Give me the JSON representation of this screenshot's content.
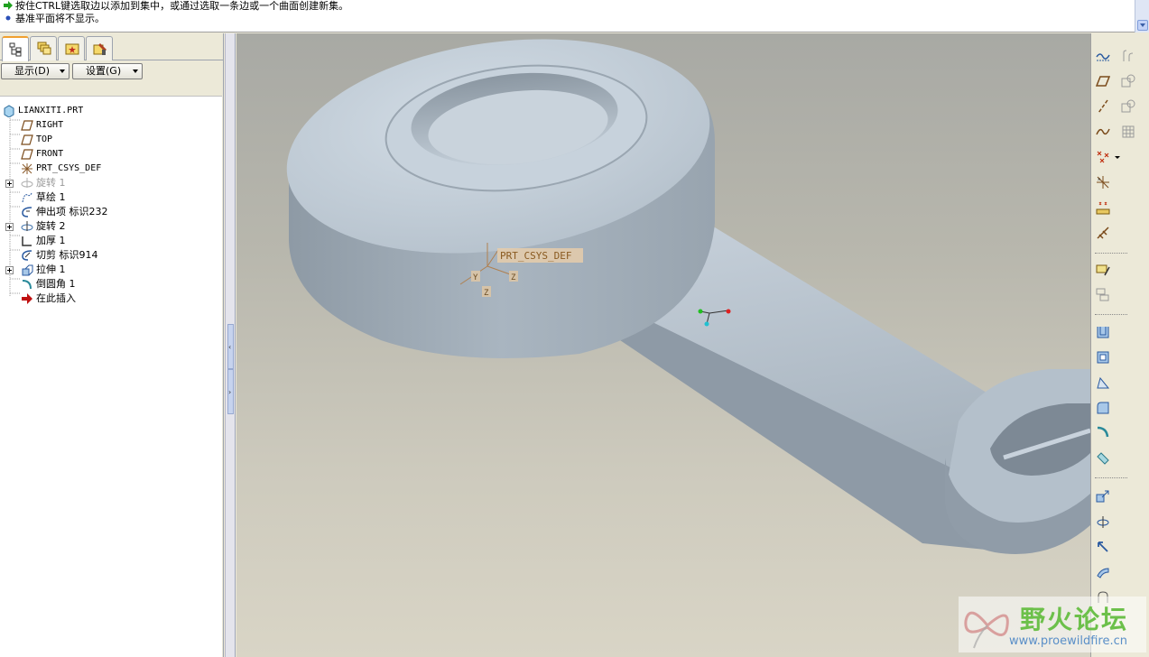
{
  "message_area": {
    "lines": [
      "按住CTRL键选取边以添加到集中，或通过选取一条边或一个曲面创建新集。",
      "基准平面将不显示。"
    ]
  },
  "model_tree_panel": {
    "tabs": [
      "model-tree-tab",
      "layers-tab",
      "favorites-tab",
      "connections-tab"
    ],
    "show_menu": "显示(D)",
    "settings_menu": "设置(G)",
    "items": [
      {
        "label": "LIANXITI.PRT",
        "icon": "part-icon",
        "expandable": false,
        "greyed": false
      },
      {
        "label": "RIGHT",
        "icon": "datum-plane-icon",
        "expandable": false,
        "greyed": false
      },
      {
        "label": "TOP",
        "icon": "datum-plane-icon",
        "expandable": false,
        "greyed": false
      },
      {
        "label": "FRONT",
        "icon": "datum-plane-icon",
        "expandable": false,
        "greyed": false
      },
      {
        "label": "PRT_CSYS_DEF",
        "icon": "csys-icon",
        "expandable": false,
        "greyed": false
      },
      {
        "label": "旋转 1",
        "icon": "revolve-icon",
        "expandable": true,
        "greyed": true
      },
      {
        "label": "草绘 1",
        "icon": "sketch-icon",
        "expandable": false,
        "greyed": false
      },
      {
        "label": "伸出项 标识232",
        "icon": "protrusion-icon",
        "expandable": false,
        "greyed": false
      },
      {
        "label": "旋转 2",
        "icon": "revolve-icon",
        "expandable": true,
        "greyed": false
      },
      {
        "label": "加厚 1",
        "icon": "thicken-icon",
        "expandable": false,
        "greyed": false
      },
      {
        "label": "切剪 标识914",
        "icon": "cut-icon",
        "expandable": false,
        "greyed": false
      },
      {
        "label": "拉伸 1",
        "icon": "extrude-icon",
        "expandable": true,
        "greyed": false
      },
      {
        "label": "倒圆角 1",
        "icon": "round-icon",
        "expandable": false,
        "greyed": false
      },
      {
        "label": "在此插入",
        "icon": "insert-arrow-icon",
        "expandable": false,
        "greyed": false
      }
    ]
  },
  "viewport": {
    "csys_label": "PRT_CSYS_DEF",
    "axis_labels": [
      "Y",
      "Z",
      "Z"
    ]
  },
  "right_toolbar": {
    "tools": [
      "datum-display-icon",
      "datum-plane-tool-icon",
      "datum-axis-tool-icon",
      "datum-curve-tool-icon",
      "datum-point-tool-icon",
      "csys-tool-icon",
      "analysis-icon",
      "sketch-tool-icon",
      "insert-annotation-icon",
      "sketch-ref-icon",
      "shell-icon",
      "draft-icon",
      "rib-icon",
      "round-tool-icon",
      "chamfer-icon",
      "hole-icon",
      "mirror-icon",
      "merge-icon",
      "trim-icon",
      "offset-icon",
      "thicken-tool-icon"
    ]
  },
  "watermark": {
    "title": "野火论坛",
    "url": "www.proewildfire.cn"
  },
  "colors": {
    "model_surface": "#b9c5cf",
    "csys_label_bg": "#e8c9a0",
    "csys_label_text": "#8a5a20",
    "watermark_green": "#6cc04a"
  }
}
